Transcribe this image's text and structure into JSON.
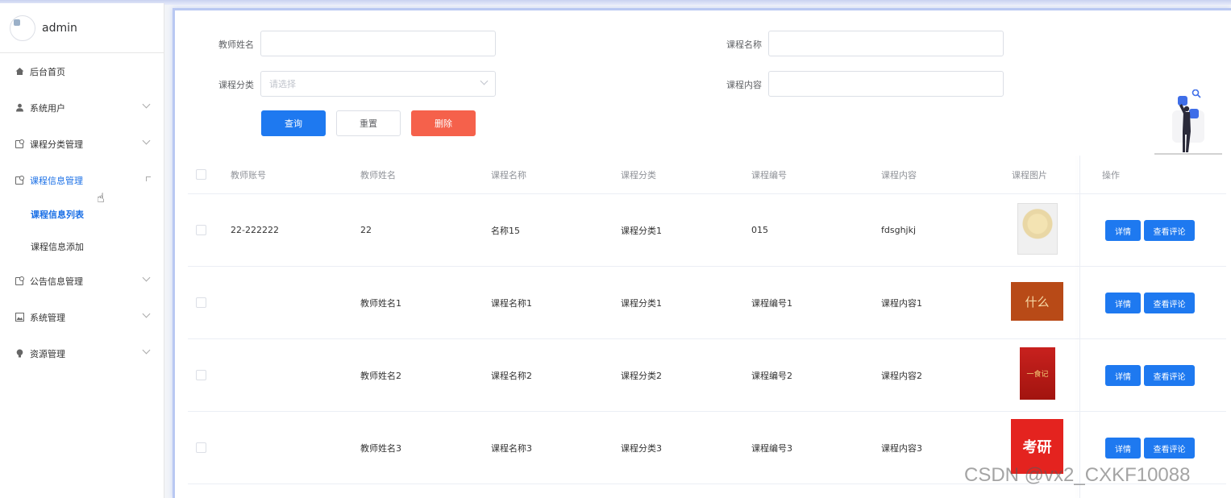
{
  "user": {
    "name": "admin"
  },
  "menu": [
    {
      "label": "后台首页",
      "icon": "home-icon"
    },
    {
      "label": "系统用户",
      "icon": "user-icon"
    },
    {
      "label": "课程分类管理",
      "icon": "folder-icon"
    },
    {
      "label": "课程信息管理",
      "icon": "folder-icon",
      "active": true,
      "sub": [
        "课程信息列表",
        "课程信息添加"
      ]
    },
    {
      "label": "公告信息管理",
      "icon": "folder-icon"
    },
    {
      "label": "系统管理",
      "icon": "picture-icon"
    },
    {
      "label": "资源管理",
      "icon": "bulb-icon"
    }
  ],
  "search": {
    "teacher_name_label": "教师姓名",
    "course_name_label": "课程名称",
    "category_label": "课程分类",
    "category_placeholder": "请选择",
    "content_label": "课程内容",
    "query": "查询",
    "reset": "重置",
    "delete": "删除"
  },
  "table": {
    "headers": [
      "教师账号",
      "教师姓名",
      "课程名称",
      "课程分类",
      "课程编号",
      "课程内容",
      "课程图片",
      "操作"
    ],
    "rows": [
      [
        "22-222222",
        "22",
        "名称15",
        "课程分类1",
        "015",
        "fdsghjkj"
      ],
      [
        "",
        "教师姓名1",
        "课程名称1",
        "课程分类1",
        "课程编号1",
        "课程内容1"
      ],
      [
        "",
        "教师姓名2",
        "课程名称2",
        "课程分类2",
        "课程编号2",
        "课程内容2"
      ],
      [
        "",
        "教师姓名3",
        "课程名称3",
        "课程分类3",
        "课程编号3",
        "课程内容3"
      ]
    ],
    "thumb_text": [
      "",
      "什么",
      "一食记",
      "考研"
    ],
    "detail": "详情",
    "comments": "查看评论"
  },
  "watermark": "CSDN @vx2_CXKF10088",
  "colors": {
    "primary": "#1e79f0",
    "danger": "#f5614b"
  }
}
